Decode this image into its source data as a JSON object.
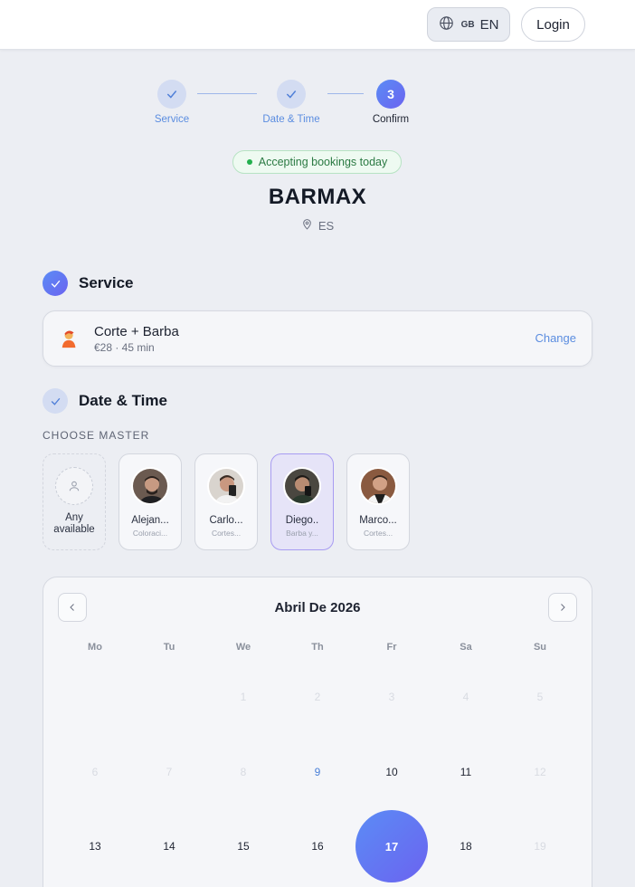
{
  "header": {
    "lang_flag": "GB",
    "lang_code": "EN",
    "login_label": "Login"
  },
  "steps": [
    {
      "label": "Service",
      "state": "done"
    },
    {
      "label": "Date & Time",
      "state": "done"
    },
    {
      "number": "3",
      "label": "Confirm",
      "state": "active"
    }
  ],
  "shop": {
    "status_badge": "Accepting bookings today",
    "name": "BARMAX",
    "location": "ES"
  },
  "service_section": {
    "title": "Service",
    "service_name": "Corte + Barba",
    "service_meta": "€28 · 45 min",
    "change_label": "Change"
  },
  "datetime_section": {
    "title": "Date & Time",
    "choose_master_label": "CHOOSE MASTER",
    "any_master": {
      "line1": "Any",
      "line2": "available"
    },
    "masters": [
      {
        "name": "Alejan...",
        "subtitle": "Coloraci...",
        "selected": false
      },
      {
        "name": "Carlo...",
        "subtitle": "Cortes...",
        "selected": false
      },
      {
        "name": "Diego..",
        "subtitle": "Barba y...",
        "selected": true
      },
      {
        "name": "Marco...",
        "subtitle": "Cortes...",
        "selected": false
      }
    ]
  },
  "calendar": {
    "month_title": "Abril De 2026",
    "weekdays": [
      "Mo",
      "Tu",
      "We",
      "Th",
      "Fr",
      "Sa",
      "Su"
    ],
    "weeks": [
      [
        null,
        null,
        "1",
        "2",
        "3",
        "4",
        "5"
      ],
      [
        "6",
        "7",
        "8",
        "9",
        "10",
        "11",
        "12"
      ],
      [
        "13",
        "14",
        "15",
        "16",
        "17",
        "18",
        "19"
      ]
    ],
    "disabled_days": [
      "1",
      "2",
      "3",
      "4",
      "5",
      "6",
      "7",
      "8",
      "12",
      "19"
    ],
    "today": "9",
    "selected_day": "17",
    "accent_color": "#5b8cf5"
  }
}
